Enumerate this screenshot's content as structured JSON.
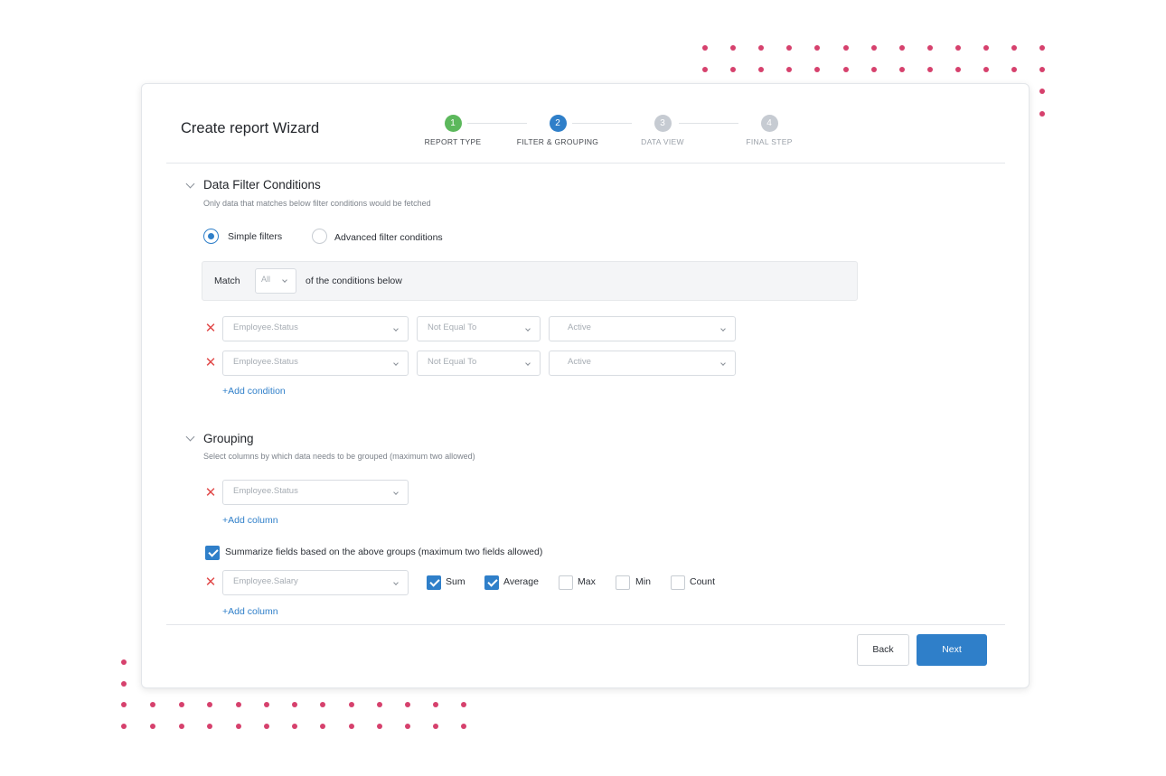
{
  "wizard": {
    "title": "Create report Wizard",
    "steps": [
      {
        "number": "1",
        "label": "REPORT TYPE",
        "state": "done"
      },
      {
        "number": "2",
        "label": "FILTER & GROUPING",
        "state": "active"
      },
      {
        "number": "3",
        "label": "DATA VIEW",
        "state": "pending"
      },
      {
        "number": "4",
        "label": "FINAL STEP",
        "state": "pending"
      }
    ]
  },
  "filter_section": {
    "title": "Data Filter Conditions",
    "subtitle": "Only data that matches below filter conditions would be fetched",
    "options": [
      {
        "label": "Simple filters",
        "selected": true
      },
      {
        "label": "Advanced filter conditions",
        "selected": false
      }
    ],
    "match": {
      "prefix": "Match",
      "value": "All",
      "suffix": "of the conditions below"
    },
    "conditions": [
      {
        "field": "Employee.Status",
        "operator": "Not Equal To",
        "value": "Active"
      },
      {
        "field": "Employee.Status",
        "operator": "Not Equal To",
        "value": "Active"
      }
    ],
    "add_label": "+Add condition"
  },
  "grouping_section": {
    "title": "Grouping",
    "subtitle": "Select columns by which data needs to be grouped (maximum two allowed)",
    "column": {
      "field": "Employee.Status"
    },
    "add_column_label": "+Add column",
    "summarize": {
      "label": "Summarize fields based on the above groups (maximum two fields allowed)",
      "checked": true,
      "field": "Employee.Salary",
      "aggregates": [
        {
          "label": "Sum",
          "checked": true
        },
        {
          "label": "Average",
          "checked": true
        },
        {
          "label": "Max",
          "checked": false
        },
        {
          "label": "Min",
          "checked": false
        },
        {
          "label": "Count",
          "checked": false
        }
      ],
      "add_column_label": "+Add column"
    }
  },
  "footer": {
    "back_label": "Back",
    "next_label": "Next"
  },
  "colors": {
    "accent": "#2f7fc9",
    "step_done": "#5cb85c",
    "step_pending": "#c6cbd2",
    "remove": "#e14b4b",
    "decor_dots": "#d6416d"
  }
}
